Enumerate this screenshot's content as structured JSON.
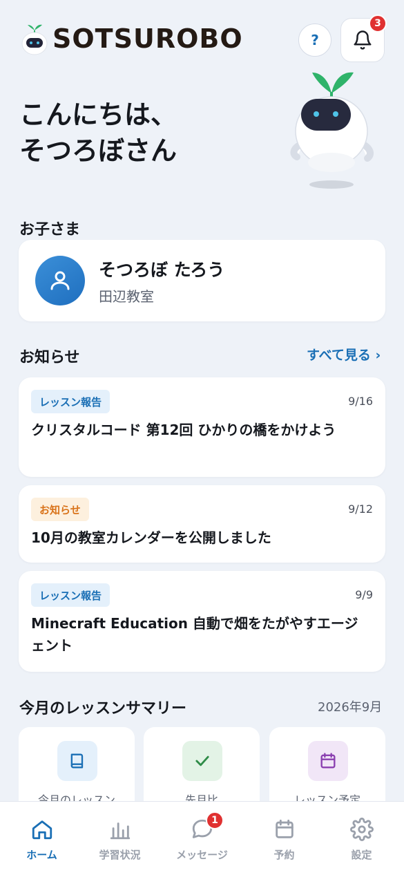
{
  "header": {
    "logo_text": "SOTSUROBO",
    "help_label": "?",
    "notification_count": "3"
  },
  "greeting": {
    "line1": "こんにちは、",
    "line2": "そつろぼさん"
  },
  "children": {
    "section_title": "お子さま",
    "child": {
      "name": "そつろぼ たろう",
      "classroom": "田辺教室"
    }
  },
  "news": {
    "section_title": "お知らせ",
    "see_all": "すべて見る ›",
    "items": [
      {
        "tag": "レッスン報告",
        "date": "9/16",
        "title": "クリスタルコード 第12回 ひかりの橋をかけよう"
      },
      {
        "tag": "お知らせ",
        "date": "9/12",
        "title": "10月の教室カレンダーを公開しました"
      },
      {
        "tag": "レッスン報告",
        "date": "9/9",
        "title": "Minecraft Education 自動で畑をたがやすエージェント"
      }
    ]
  },
  "summary": {
    "section_title": "今月のレッスンサマリー",
    "month": "2026年9月",
    "cards": [
      {
        "label": "今月のレッスン",
        "icon": "book-icon"
      },
      {
        "label": "先月比",
        "icon": "check-icon"
      },
      {
        "label": "レッスン予定",
        "icon": "calendar-icon"
      }
    ]
  },
  "nav": {
    "items": [
      {
        "label": "ホーム",
        "icon": "home-icon"
      },
      {
        "label": "学習状況",
        "icon": "bar-chart-icon"
      },
      {
        "label": "メッセージ",
        "icon": "chat-icon"
      },
      {
        "label": "予約",
        "icon": "calendar-icon"
      },
      {
        "label": "設定",
        "icon": "gear-icon"
      }
    ],
    "message_badge": "1"
  },
  "colors": {
    "accent": "#1a6fb5",
    "badge": "#e03131",
    "background": "#eef2f8",
    "tag_orange": "#d9731a"
  }
}
